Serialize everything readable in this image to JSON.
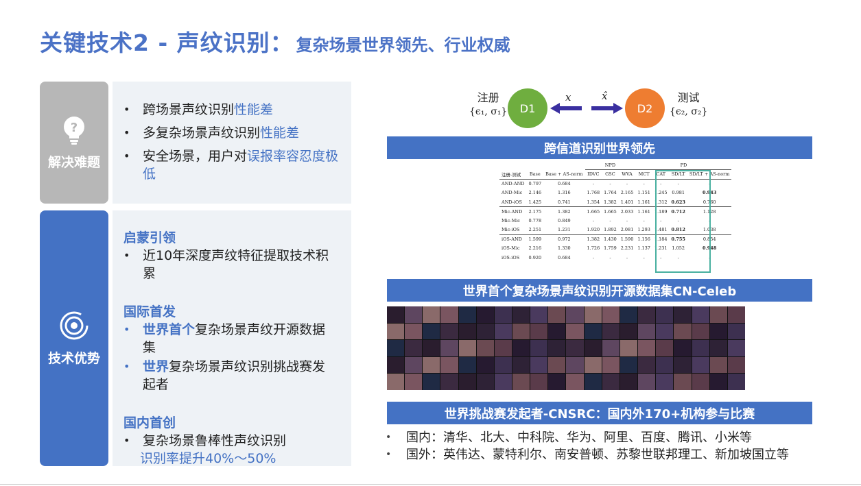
{
  "title": {
    "main": "关键技术2 - 声纹识别：",
    "sub": "复杂场景世界领先、行业权威"
  },
  "problems": {
    "label": "解决难题",
    "icon": "lightbulb-question-icon",
    "items": [
      {
        "text": "跨场景声纹识别",
        "highlight": "性能差"
      },
      {
        "text": "多复杂场景声纹识别",
        "highlight": "性能差"
      },
      {
        "text": "安全场景，用户对",
        "highlight": "误报率容忍度极低"
      }
    ]
  },
  "advantages": {
    "label": "技术优势",
    "icon": "target-ring-icon",
    "sections": [
      {
        "heading": "启蒙引领",
        "items": [
          {
            "text": "近10年深度声纹特征提取技术积累"
          }
        ]
      },
      {
        "heading": "国际首发",
        "items": [
          {
            "bold": "世界首个",
            "text": "复杂场景声纹开源数据集"
          },
          {
            "bold": "世界",
            "text": "复杂场景声纹识别挑战赛发起者"
          }
        ]
      },
      {
        "heading": "国内首创",
        "items": [
          {
            "text": "复杂场景鲁棒性声纹识别",
            "highlight": "识别率提升40%～50%"
          }
        ]
      }
    ]
  },
  "diagram": {
    "left_label": "注册",
    "left_params": "{ϵ₁, σ₁}",
    "right_label": "测试",
    "right_params": "{ϵ₂, σ₂}",
    "node1": "D1",
    "node2": "D2",
    "var_left": "x",
    "var_right": "x̂",
    "colors": {
      "d1": "#6fae3f",
      "d2": "#ee7d31",
      "arrow": "#3a2fa0"
    }
  },
  "bars": {
    "cross_channel": "跨信道识别世界领先",
    "dataset": "世界首个复杂场景声纹识别开源数据集CN-Celeb",
    "challenge": "世界挑战赛发起者-CNSRC：国内外170+机构参与比赛"
  },
  "table": {
    "group_npd": "NPD",
    "group_pd": "PD",
    "headers": [
      "注册-测试",
      "Base",
      "Base + AS-norm",
      "IDVC",
      "GSC",
      "WVA",
      "MCT",
      "CAT",
      "SD/LT",
      "SD/LT + AS-norm"
    ],
    "rows": [
      [
        "AND-AND",
        "0.797",
        "0.684",
        "-",
        "-",
        "-",
        "-",
        "-",
        "-",
        "-"
      ],
      [
        "AND-Mic",
        "2.146",
        "1.316",
        "1.768",
        "1.764",
        "2.165",
        "1.151",
        "1.245",
        "0.981",
        "0.943"
      ],
      [
        "AND-iOS",
        "1.425",
        "0.741",
        "1.354",
        "1.382",
        "1.401",
        "1.161",
        "1.312",
        "0.623",
        "0.760"
      ],
      [
        "Mic-AND",
        "2.175",
        "1.382",
        "1.665",
        "1.665",
        "2.033",
        "1.161",
        "1.189",
        "0.712",
        "1.128"
      ],
      [
        "Mic-Mic",
        "0.778",
        "0.849",
        "-",
        "-",
        "-",
        "-",
        "-",
        "-",
        "-"
      ],
      [
        "Mic-iOS",
        "2.251",
        "1.231",
        "1.920",
        "1.892",
        "2.081",
        "1.293",
        "1.481",
        "0.812",
        "1.038"
      ],
      [
        "iOS-AND",
        "1.599",
        "0.972",
        "1.382",
        "1.430",
        "1.590",
        "1.156",
        "1.184",
        "0.755",
        "0.854"
      ],
      [
        "iOS-Mic",
        "2.216",
        "1.330",
        "1.726",
        "1.759",
        "2.231",
        "1.137",
        "1.231",
        "1.052",
        "0.948"
      ],
      [
        "iOS-iOS",
        "0.920",
        "0.684",
        "-",
        "-",
        "-",
        "-",
        "-",
        "-",
        "-"
      ]
    ],
    "bold_cells": [
      [
        1,
        9
      ],
      [
        2,
        8
      ],
      [
        3,
        8
      ],
      [
        5,
        8
      ],
      [
        6,
        8
      ],
      [
        7,
        9
      ]
    ],
    "highlight_color": "#48b0a0"
  },
  "orgs": {
    "domestic": "国内：清华、北大、中科院、华为、阿里、百度、腾讯、小米等",
    "international": "国外：英伟达、蒙特利尔、南安普顿、苏黎世联邦理工、新加坡国立等"
  }
}
